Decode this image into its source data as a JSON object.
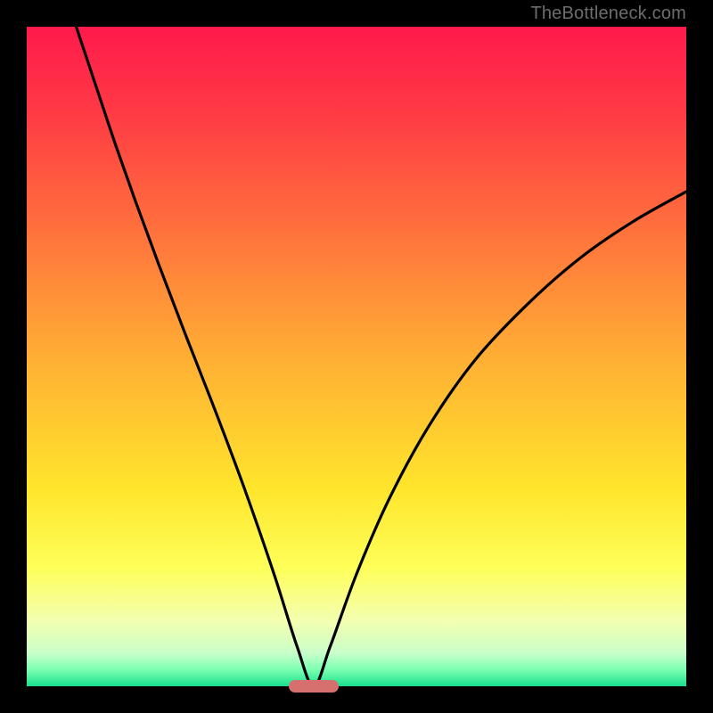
{
  "watermark": "TheBottleneck.com",
  "chart_data": {
    "type": "line",
    "title": "",
    "xlabel": "",
    "ylabel": "",
    "xlim": [
      0,
      1
    ],
    "ylim": [
      0,
      1
    ],
    "background": {
      "gradient_stops": [
        {
          "pos": 0.0,
          "color": "#ff1a4b"
        },
        {
          "pos": 0.12,
          "color": "#ff3745"
        },
        {
          "pos": 0.3,
          "color": "#ff6e3d"
        },
        {
          "pos": 0.5,
          "color": "#ffae34"
        },
        {
          "pos": 0.7,
          "color": "#ffe52c"
        },
        {
          "pos": 0.82,
          "color": "#feff58"
        },
        {
          "pos": 0.9,
          "color": "#f4ffb0"
        },
        {
          "pos": 0.95,
          "color": "#c9ffca"
        },
        {
          "pos": 0.975,
          "color": "#7affb0"
        },
        {
          "pos": 1.0,
          "color": "#18e08e"
        }
      ]
    },
    "curve": {
      "minimum_x": 0.435,
      "left_start": {
        "x": 0.075,
        "y": 1.0
      },
      "right_end": {
        "x": 1.0,
        "y": 0.75
      },
      "points": [
        {
          "x": 0.075,
          "y": 1.0
        },
        {
          "x": 0.09,
          "y": 0.955
        },
        {
          "x": 0.11,
          "y": 0.895
        },
        {
          "x": 0.135,
          "y": 0.82
        },
        {
          "x": 0.165,
          "y": 0.735
        },
        {
          "x": 0.2,
          "y": 0.64
        },
        {
          "x": 0.24,
          "y": 0.535
        },
        {
          "x": 0.285,
          "y": 0.42
        },
        {
          "x": 0.33,
          "y": 0.3
        },
        {
          "x": 0.375,
          "y": 0.17
        },
        {
          "x": 0.41,
          "y": 0.06
        },
        {
          "x": 0.435,
          "y": 0.0
        },
        {
          "x": 0.46,
          "y": 0.06
        },
        {
          "x": 0.5,
          "y": 0.17
        },
        {
          "x": 0.55,
          "y": 0.285
        },
        {
          "x": 0.61,
          "y": 0.395
        },
        {
          "x": 0.68,
          "y": 0.495
        },
        {
          "x": 0.76,
          "y": 0.58
        },
        {
          "x": 0.84,
          "y": 0.65
        },
        {
          "x": 0.92,
          "y": 0.705
        },
        {
          "x": 1.0,
          "y": 0.75
        }
      ]
    },
    "marker": {
      "x_center": 0.435,
      "width": 0.075,
      "color": "#d6706f"
    }
  }
}
